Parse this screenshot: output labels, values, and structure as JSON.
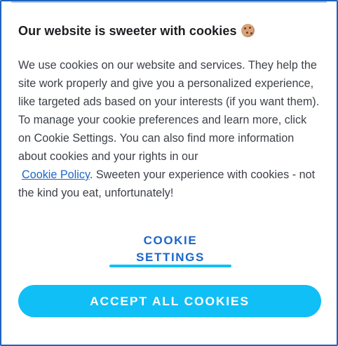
{
  "dialog": {
    "title": "Our website is sweeter with cookies",
    "title_icon": "cookie-icon",
    "body_before_link": "We use cookies on our website and services. They help the site work properly and give you a personalized experience, like targeted ads based on your interests (if you want them). To manage your cookie preferences and learn more, click on Cookie Settings. You can also find more information about cookies and your rights in our",
    "policy_link": "Cookie Policy",
    "body_after_link": ". Sweeten your experience with cookies - not the kind you eat, unfortunately!",
    "settings_line1": "COOKIE",
    "settings_line2": "SETTINGS",
    "accept_label": "ACCEPT ALL COOKIES"
  },
  "colors": {
    "border": "#1e63c0",
    "link": "#1a67c9",
    "accent": "#10bff5",
    "accept_text": "#ffffff"
  }
}
